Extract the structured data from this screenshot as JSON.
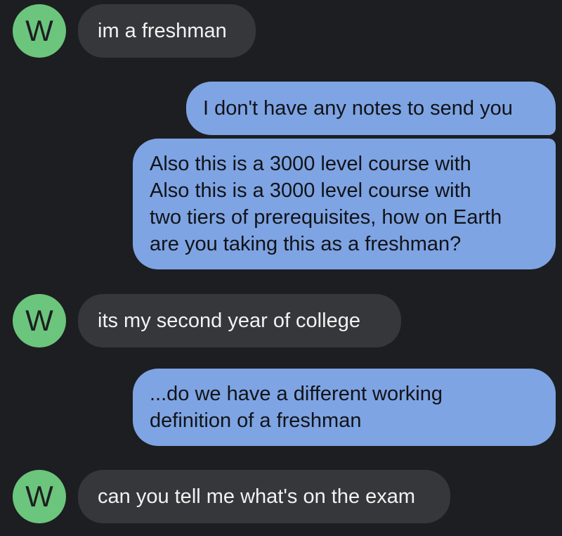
{
  "messages": [
    {
      "sender": "W",
      "direction": "incoming",
      "text": "im a freshman"
    },
    {
      "sender": "me",
      "direction": "outgoing",
      "text": "I don't have any notes to send you"
    },
    {
      "sender": "me",
      "direction": "outgoing",
      "text": "Also this is a 3000 level course with\nAlso this is a 3000 level course with\ntwo tiers of prerequisites, how on Earth\nare you taking this as a freshman?"
    },
    {
      "sender": "W",
      "direction": "incoming",
      "text": "its my second year of college"
    },
    {
      "sender": "me",
      "direction": "outgoing",
      "text": "...do we have a different working\ndefinition of a freshman"
    },
    {
      "sender": "W",
      "direction": "incoming",
      "text": "can you tell me what's on the exam"
    }
  ],
  "colors": {
    "background": "#1d1e21",
    "incoming_bubble": "#36373b",
    "outgoing_bubble": "#7ea4e3",
    "avatar": "#6cc57c"
  }
}
